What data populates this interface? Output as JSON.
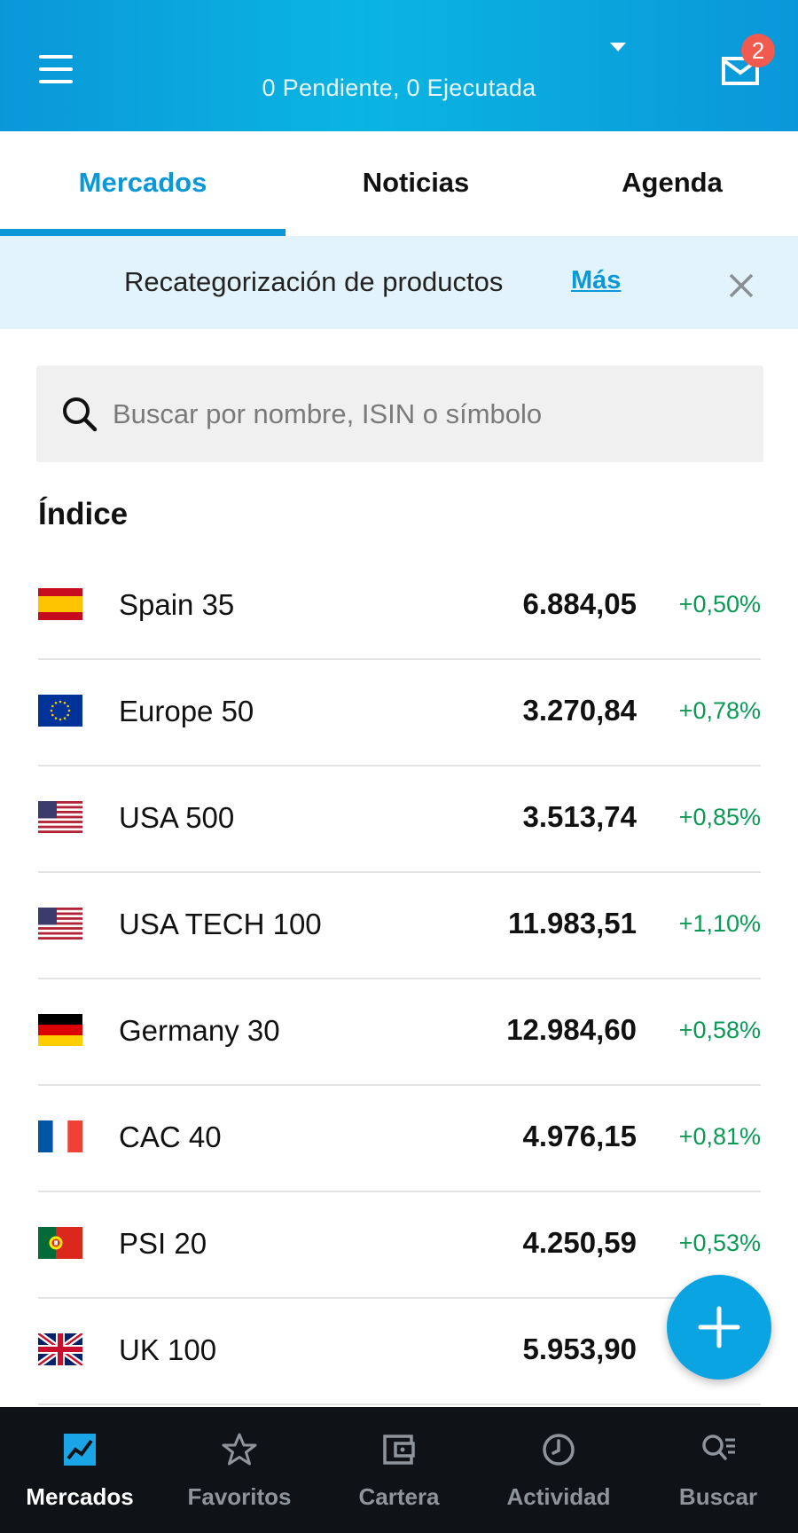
{
  "header": {
    "status": "0 Pendiente, 0 Ejecutada",
    "badge_count": "2"
  },
  "tabs": [
    {
      "label": "Mercados",
      "active": true
    },
    {
      "label": "Noticias",
      "active": false
    },
    {
      "label": "Agenda",
      "active": false
    }
  ],
  "banner": {
    "text": "Recategorización de productos",
    "link": "Más"
  },
  "search": {
    "placeholder": "Buscar por nombre, ISIN o símbolo"
  },
  "section": {
    "title": "Índice"
  },
  "indices": [
    {
      "flag": "spain-flag-icon",
      "name": "Spain 35",
      "price": "6.884,05",
      "change": "+0,50%"
    },
    {
      "flag": "eu-flag-icon",
      "name": "Europe 50",
      "price": "3.270,84",
      "change": "+0,78%"
    },
    {
      "flag": "usa-flag-icon",
      "name": "USA 500",
      "price": "3.513,74",
      "change": "+0,85%"
    },
    {
      "flag": "usa-flag-icon",
      "name": "USA TECH 100",
      "price": "11.983,51",
      "change": "+1,10%"
    },
    {
      "flag": "germany-flag-icon",
      "name": "Germany 30",
      "price": "12.984,60",
      "change": "+0,58%"
    },
    {
      "flag": "france-flag-icon",
      "name": "CAC 40",
      "price": "4.976,15",
      "change": "+0,81%"
    },
    {
      "flag": "portugal-flag-icon",
      "name": "PSI 20",
      "price": "4.250,59",
      "change": "+0,53%"
    },
    {
      "flag": "uk-flag-icon",
      "name": "UK 100",
      "price": "5.953,90",
      "change": ""
    }
  ],
  "colors": {
    "brand": "#0a99d6",
    "positive": "#0a9a55",
    "nav_bg": "#0f1318",
    "badge": "#f15a4f"
  },
  "bottom_nav": [
    {
      "label": "Mercados",
      "icon": "chart-icon",
      "active": true
    },
    {
      "label": "Favoritos",
      "icon": "star-icon",
      "active": false
    },
    {
      "label": "Cartera",
      "icon": "wallet-icon",
      "active": false
    },
    {
      "label": "Actividad",
      "icon": "clock-icon",
      "active": false
    },
    {
      "label": "Buscar",
      "icon": "search-list-icon",
      "active": false
    }
  ]
}
